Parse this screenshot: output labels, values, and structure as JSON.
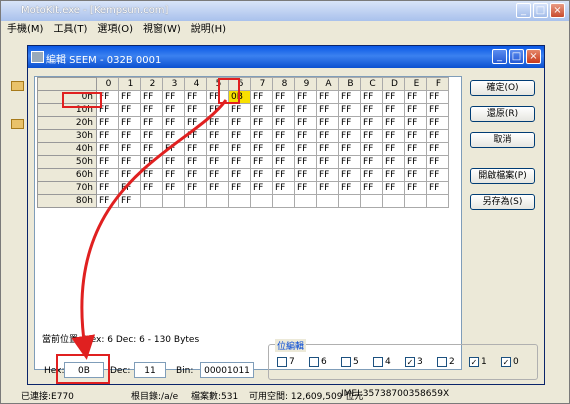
{
  "app": {
    "title": "MotoKit.exe - [Kempsun.com]",
    "menu": [
      "手機(M)",
      "工具(T)",
      "選項(O)",
      "視窗(W)",
      "說明(H)"
    ]
  },
  "dialog": {
    "title": "編輯 SEEM - 032B 0001",
    "col_headers": [
      "0",
      "1",
      "2",
      "3",
      "4",
      "5",
      "6",
      "7",
      "8",
      "9",
      "A",
      "B",
      "C",
      "D",
      "E",
      "F"
    ],
    "rows": [
      {
        "label": "0h",
        "cells": [
          "FF",
          "FF",
          "FF",
          "FF",
          "FF",
          "FF",
          "0B",
          "FF",
          "FF",
          "FF",
          "FF",
          "FF",
          "FF",
          "FF",
          "FF",
          "FF"
        ]
      },
      {
        "label": "10h",
        "cells": [
          "FF",
          "FF",
          "FF",
          "FF",
          "FF",
          "FF",
          "FF",
          "FF",
          "FF",
          "FF",
          "FF",
          "FF",
          "FF",
          "FF",
          "FF",
          "FF"
        ]
      },
      {
        "label": "20h",
        "cells": [
          "FF",
          "FF",
          "FF",
          "FF",
          "FF",
          "FF",
          "FF",
          "FF",
          "FF",
          "FF",
          "FF",
          "FF",
          "FF",
          "FF",
          "FF",
          "FF"
        ]
      },
      {
        "label": "30h",
        "cells": [
          "FF",
          "FF",
          "FF",
          "FF",
          "FF",
          "FF",
          "FF",
          "FF",
          "FF",
          "FF",
          "FF",
          "FF",
          "FF",
          "FF",
          "FF",
          "FF"
        ]
      },
      {
        "label": "40h",
        "cells": [
          "FF",
          "FF",
          "FF",
          "FF",
          "FF",
          "FF",
          "FF",
          "FF",
          "FF",
          "FF",
          "FF",
          "FF",
          "FF",
          "FF",
          "FF",
          "FF"
        ]
      },
      {
        "label": "50h",
        "cells": [
          "FF",
          "FF",
          "FF",
          "FF",
          "FF",
          "FF",
          "FF",
          "FF",
          "FF",
          "FF",
          "FF",
          "FF",
          "FF",
          "FF",
          "FF",
          "FF"
        ]
      },
      {
        "label": "60h",
        "cells": [
          "FF",
          "FF",
          "FF",
          "FF",
          "FF",
          "FF",
          "FF",
          "FF",
          "FF",
          "FF",
          "FF",
          "FF",
          "FF",
          "FF",
          "FF",
          "FF"
        ]
      },
      {
        "label": "70h",
        "cells": [
          "FF",
          "FF",
          "FF",
          "FF",
          "FF",
          "FF",
          "FF",
          "FF",
          "FF",
          "FF",
          "FF",
          "FF",
          "FF",
          "FF",
          "FF",
          "FF"
        ]
      },
      {
        "label": "80h",
        "cells": [
          "FF",
          "FF",
          "",
          "",
          "",
          "",
          "",
          "",
          "",
          "",
          "",
          "",
          "",
          "",
          "",
          ""
        ]
      }
    ],
    "selected": {
      "row": 0,
      "col": 6
    },
    "position_text": "當前位置: Hex: 6  Dec: 6  - 130 Bytes",
    "hex_label": "Hex:",
    "hex_value": "0B",
    "dec_label": "Dec:",
    "dec_value": "11",
    "bin_label": "Bin:",
    "bin_value": "00001011",
    "buttons": {
      "ok": "確定(O)",
      "restore": "還原(R)",
      "cancel": "取消",
      "open_file": "開啟檔案(P)",
      "save_as": "另存為(S)"
    },
    "bit_group": {
      "label": "位編輯",
      "bits": [
        {
          "label": "7",
          "checked": false
        },
        {
          "label": "6",
          "checked": false
        },
        {
          "label": "5",
          "checked": false
        },
        {
          "label": "4",
          "checked": false
        },
        {
          "label": "3",
          "checked": true
        },
        {
          "label": "2",
          "checked": false
        },
        {
          "label": "1",
          "checked": true
        },
        {
          "label": "0",
          "checked": true
        }
      ]
    }
  },
  "status": {
    "connected": "已連接:E770",
    "dir": "根目錄:/a/e",
    "files": "檔案數:531",
    "space": "可用空間: 12,609,509 位元",
    "imei": "IMEI:35738700358659X"
  },
  "colors": {
    "highlight": "#f8e000",
    "annotation": "#e02020"
  }
}
